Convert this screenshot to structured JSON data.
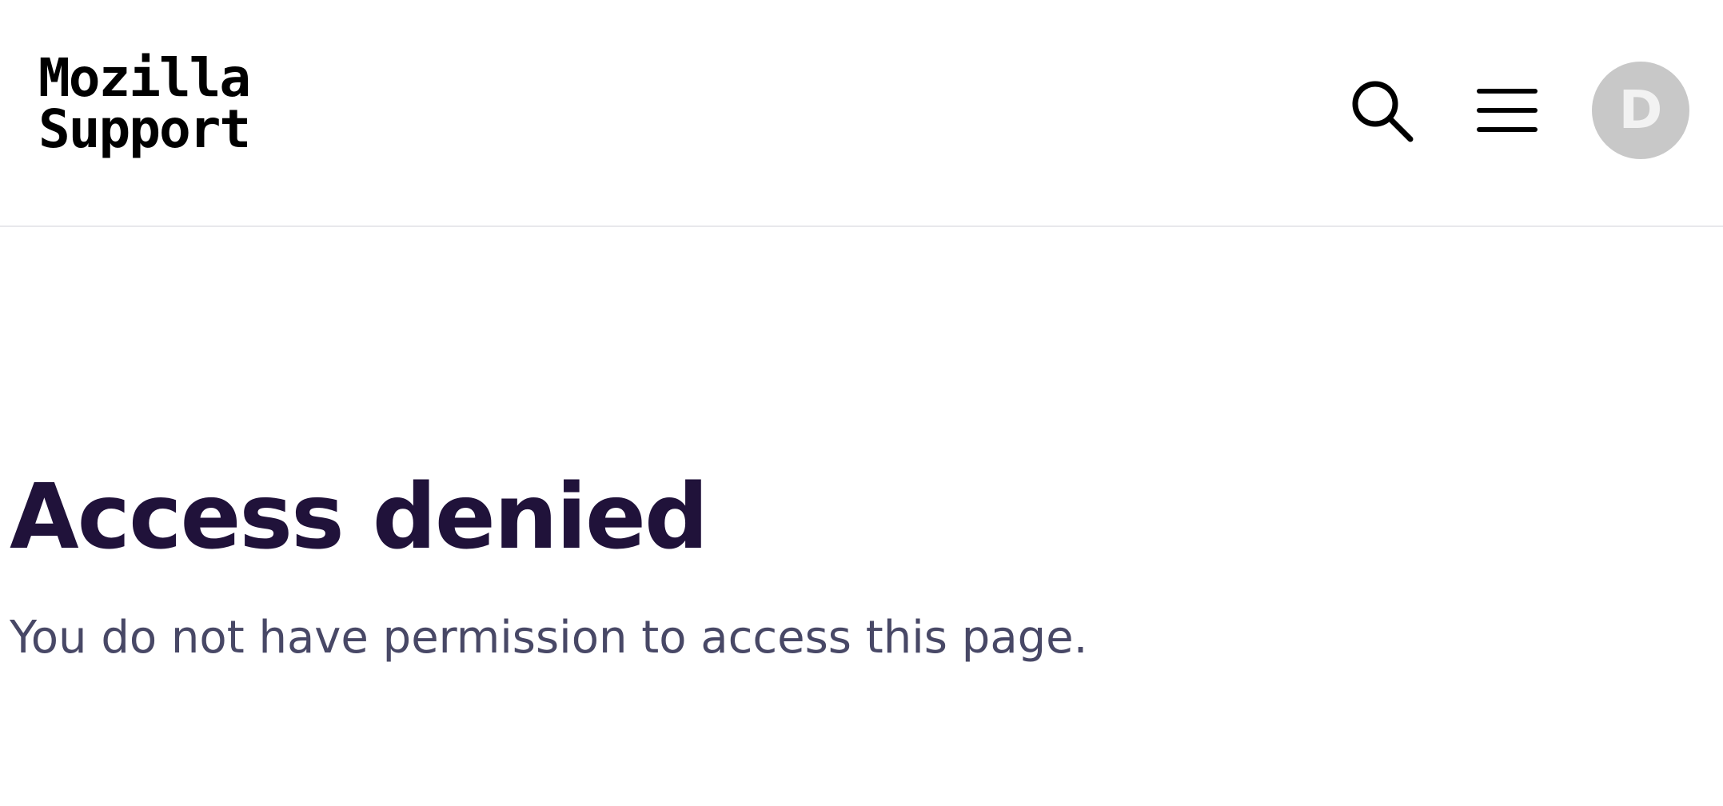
{
  "header": {
    "logo_line1": "Mozilla",
    "logo_line2": "Support",
    "search_icon": "search-icon",
    "menu_icon": "hamburger-menu-icon",
    "avatar_initial": "D",
    "avatar_color": "#c8c8c8"
  },
  "main": {
    "title": "Access denied",
    "message": "You do not have permission to access this page."
  },
  "colors": {
    "title": "#20123a",
    "message": "#484866",
    "divider": "#e8e8ec"
  }
}
